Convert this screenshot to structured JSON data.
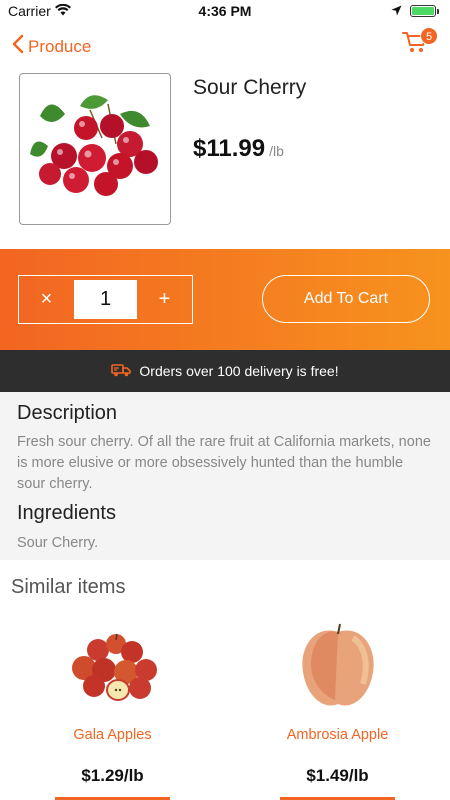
{
  "status_bar": {
    "carrier": "Carrier",
    "time": "4:36 PM"
  },
  "nav": {
    "back_label": "Produce",
    "cart_count": "5"
  },
  "product": {
    "name": "Sour Cherry",
    "price": "$11.99",
    "unit": "/lb",
    "image_icon": "cherries-image"
  },
  "quantity": {
    "minus_label": "×",
    "value": "1",
    "plus_label": "+"
  },
  "add_to_cart_label": "Add To Cart",
  "delivery_banner": {
    "icon": "delivery-truck-icon",
    "text": "Orders over 100 delivery is free!"
  },
  "description": {
    "title": "Description",
    "text": "Fresh sour cherry. Of all the rare fruit at California markets, none is more elusive or more obsessively hunted than the humble sour cherry."
  },
  "ingredients": {
    "title": "Ingredients",
    "text": "Sour Cherry."
  },
  "similar": {
    "title": "Similar items",
    "items": [
      {
        "name": "Gala Apples",
        "price": "$1.29/lb"
      },
      {
        "name": "Ambrosia Apple",
        "price": "$1.49/lb"
      }
    ]
  },
  "colors": {
    "accent": "#f26522",
    "accent_end": "#f7931e",
    "banner_bg": "#2e2e2e",
    "desc_bg": "#f4f4f4"
  }
}
